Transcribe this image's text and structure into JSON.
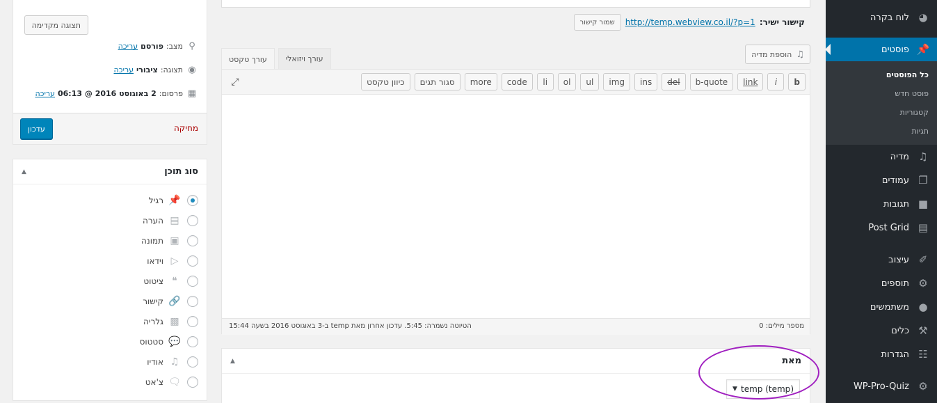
{
  "publish": {
    "preview_label": "תצוגה מקדימה",
    "status_label": "מצב:",
    "status_value": "פורסם",
    "status_edit": "עריכה",
    "visibility_label": "תצוגה:",
    "visibility_value": "ציבורי",
    "visibility_edit": "עריכה",
    "published_label": "פרסום:",
    "published_value": "2 באוגוסט 2016 @ 06:13",
    "published_edit": "עריכה",
    "trash_label": "מחיקה",
    "update_label": "עדכון"
  },
  "format": {
    "title": "סוג תוכן",
    "items": [
      {
        "label": "רגיל",
        "icon": "pin-icon",
        "checked": true
      },
      {
        "label": "הערה",
        "icon": "aside-icon",
        "checked": false
      },
      {
        "label": "תמונה",
        "icon": "image-icon",
        "checked": false
      },
      {
        "label": "וידאו",
        "icon": "video-icon",
        "checked": false
      },
      {
        "label": "ציטוט",
        "icon": "quote-icon",
        "checked": false
      },
      {
        "label": "קישור",
        "icon": "link-icon",
        "checked": false
      },
      {
        "label": "גלריה",
        "icon": "gallery-icon",
        "checked": false
      },
      {
        "label": "סטטוס",
        "icon": "status-icon",
        "checked": false
      },
      {
        "label": "אודיו",
        "icon": "audio-icon",
        "checked": false
      },
      {
        "label": "צ'אט",
        "icon": "chat-icon",
        "checked": false
      }
    ]
  },
  "permalink": {
    "label": "קישור ישיר:",
    "url": "http://temp.webview.co.il/?p=1",
    "button": "שמור קישור"
  },
  "editor": {
    "add_media": "הוספת מדיה",
    "tab_visual": "עורך ויזואלי",
    "tab_text": "עורך טקסט",
    "buttons": [
      "b",
      "i",
      "link",
      "b-quote",
      "del",
      "ins",
      "img",
      "ul",
      "ol",
      "li",
      "code",
      "more",
      "סגור תגים",
      "כיוון טקסט"
    ],
    "word_count": "מספר מילים: 0",
    "autosave": "הטיוטה נשמרה: 5:45. עדכון אחרון מאת temp ב-3 באוגוסט 2016 בשעה 15:44"
  },
  "author": {
    "title": "מאת",
    "selected": "(temp (temp"
  },
  "menu": {
    "dashboard": "לוח בקרה",
    "posts": "פוסטים",
    "posts_sub": [
      "כל הפוסטים",
      "פוסט חדש",
      "קטגוריות",
      "תגיות"
    ],
    "media": "מדיה",
    "pages": "עמודים",
    "comments": "תגובות",
    "post_grid": "Post Grid",
    "appearance": "עיצוב",
    "plugins": "תוספים",
    "users": "משתמשים",
    "tools": "כלים",
    "settings": "הגדרות",
    "wp_pro_quiz": "WP-Pro-Quiz"
  },
  "colors": {
    "sidebar_bg": "#23282d",
    "active_blue": "#0073aa",
    "highlight": "#a020c0"
  }
}
